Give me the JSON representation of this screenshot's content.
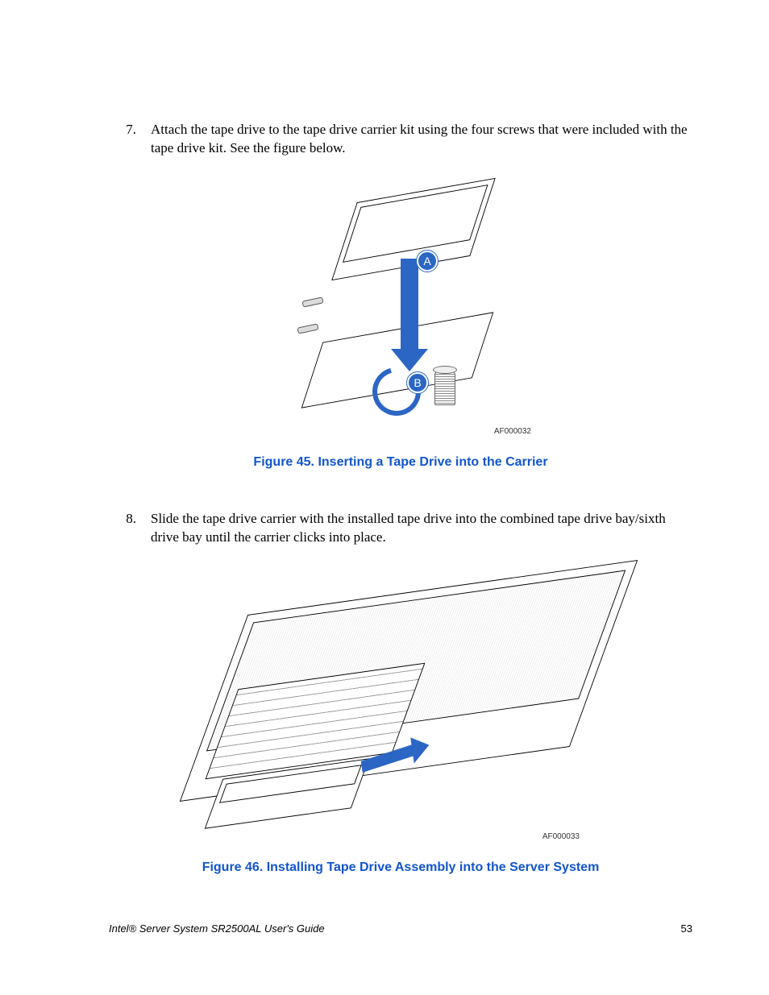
{
  "steps": {
    "s7": {
      "num": "7.",
      "text": "Attach the tape drive to the tape drive carrier kit using the four screws that were included with the tape drive kit. See the figure below."
    },
    "s8": {
      "num": "8.",
      "text": "Slide the tape drive carrier with the installed tape drive into the combined tape drive bay/sixth drive bay until the carrier clicks into place."
    }
  },
  "figures": {
    "f45": {
      "caption": "Figure 45. Inserting a Tape Drive into the Carrier",
      "labelA": "A",
      "labelB": "B",
      "code": "AF000032"
    },
    "f46": {
      "caption": "Figure 46. Installing Tape Drive Assembly into the Server System",
      "code": "AF000033"
    }
  },
  "footer": {
    "title": "Intel® Server System SR2500AL User's Guide",
    "page": "53"
  }
}
